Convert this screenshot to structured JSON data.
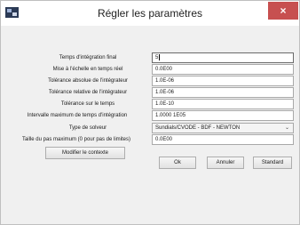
{
  "window": {
    "title": "Régler les paramètres",
    "close_symbol": "×",
    "icon": "app-icon"
  },
  "form": {
    "rows": [
      {
        "label": "Temps d'intégration final",
        "value": "5"
      },
      {
        "label": "Mise à l'échelle en temps réel",
        "value": "0.0E00"
      },
      {
        "label": "Tolérance absolue de l'intégrateur",
        "value": "1.0E-06"
      },
      {
        "label": "Tolérance relative de l'intégrateur",
        "value": "1.0E-06"
      },
      {
        "label": "Tolérance sur le temps",
        "value": "1.0E-10"
      },
      {
        "label": "Intervalle maximum de temps d'intégration",
        "value": "1.0000 1E05"
      },
      {
        "label": "Type de solveur",
        "value": "Sundials/CVODE - BDF - NEWTON"
      },
      {
        "label": "Taille du pas maximum (0 pour pas de limites)",
        "value": "0.0E00"
      }
    ]
  },
  "buttons": {
    "modify_context": "Modifier le contexte",
    "ok": "Ok",
    "cancel": "Annuler",
    "standard": "Standard"
  },
  "colors": {
    "close_bg": "#c75050",
    "dialog_bg": "#f0f0f0"
  }
}
